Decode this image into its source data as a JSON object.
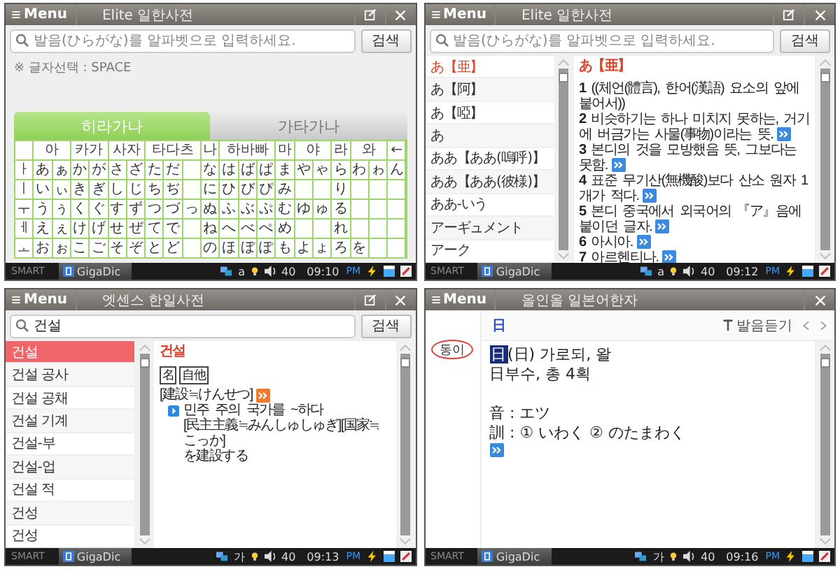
{
  "screens": [
    {
      "kind": "keyboard",
      "title": "Elite 일한사전",
      "menu": "Menu",
      "edit_icon": true,
      "search": {
        "placeholder": "발음(ひらがな)를 알파벳으로 입력하세요.",
        "button": "검색"
      },
      "hint": "※ 글자선택 : SPACE",
      "kana_tabs": [
        {
          "label": "히라가나",
          "selected": true
        },
        {
          "label": "가타가나",
          "selected": false
        }
      ],
      "kana_header": [
        "아",
        "카가",
        "사자",
        "타다츠",
        "나",
        "하바빠",
        "마",
        "야",
        "라",
        "와",
        "←"
      ],
      "kana_rows": [
        {
          "vowel": "ㅏ",
          "groups": [
            [
              {
                "kana": "あ"
              },
              {
                "kana": "ぁ"
              }
            ],
            [
              {
                "kana": "か"
              },
              {
                "kana": "が"
              }
            ],
            [
              {
                "kana": "さ"
              },
              {
                "kana": "ざ"
              }
            ],
            [
              {
                "kana": "た"
              },
              {
                "kana": "だ"
              },
              {
                "blank": true
              }
            ],
            [
              {
                "kana": "な"
              }
            ],
            [
              {
                "kana": "は"
              },
              {
                "kana": "ば"
              },
              {
                "kana": "ぱ"
              }
            ],
            [
              {
                "kana": "ま"
              }
            ],
            [
              {
                "kana": "や"
              },
              {
                "kana": "ゃ"
              }
            ],
            [
              {
                "kana": "ら"
              }
            ],
            [
              {
                "kana": "わ"
              },
              {
                "kana": "ゎ"
              }
            ],
            [
              {
                "kana": "ん"
              }
            ]
          ]
        },
        {
          "vowel": "ㅣ",
          "groups": [
            [
              {
                "kana": "い"
              },
              {
                "kana": "ぃ"
              }
            ],
            [
              {
                "kana": "き"
              },
              {
                "kana": "ぎ"
              }
            ],
            [
              {
                "kana": "し"
              },
              {
                "kana": "じ"
              }
            ],
            [
              {
                "kana": "ち"
              },
              {
                "kana": "ぢ"
              },
              {
                "blank": true
              }
            ],
            [
              {
                "kana": "に"
              }
            ],
            [
              {
                "kana": "ひ"
              },
              {
                "kana": "び"
              },
              {
                "kana": "ぴ"
              }
            ],
            [
              {
                "kana": "み"
              }
            ],
            [
              {
                "blank": true
              },
              {
                "blank": true
              }
            ],
            [
              {
                "kana": "り"
              }
            ],
            [
              {
                "blank": true
              },
              {
                "blank": true
              }
            ],
            [
              {
                "blank": true
              }
            ]
          ]
        },
        {
          "vowel": "ㅜ",
          "groups": [
            [
              {
                "kana": "う"
              },
              {
                "kana": "ぅ"
              }
            ],
            [
              {
                "kana": "く"
              },
              {
                "kana": "ぐ"
              }
            ],
            [
              {
                "kana": "す"
              },
              {
                "kana": "ず"
              }
            ],
            [
              {
                "kana": "つ"
              },
              {
                "kana": "づ"
              },
              {
                "kana": "っ"
              }
            ],
            [
              {
                "kana": "ぬ"
              }
            ],
            [
              {
                "kana": "ふ"
              },
              {
                "kana": "ぶ"
              },
              {
                "kana": "ぷ"
              }
            ],
            [
              {
                "kana": "む"
              }
            ],
            [
              {
                "kana": "ゆ"
              },
              {
                "kana": "ゅ"
              }
            ],
            [
              {
                "kana": "る"
              }
            ],
            [
              {
                "blank": true
              },
              {
                "blank": true
              }
            ],
            [
              {
                "blank": true
              }
            ]
          ]
        },
        {
          "vowel": "ㅔ",
          "groups": [
            [
              {
                "kana": "え"
              },
              {
                "kana": "ぇ"
              }
            ],
            [
              {
                "kana": "け"
              },
              {
                "kana": "げ"
              }
            ],
            [
              {
                "kana": "せ"
              },
              {
                "kana": "ぜ"
              }
            ],
            [
              {
                "kana": "て"
              },
              {
                "kana": "で"
              },
              {
                "blank": true
              }
            ],
            [
              {
                "kana": "ね"
              }
            ],
            [
              {
                "kana": "へ"
              },
              {
                "kana": "べ"
              },
              {
                "kana": "ぺ"
              }
            ],
            [
              {
                "kana": "め"
              }
            ],
            [
              {
                "blank": true
              },
              {
                "blank": true
              }
            ],
            [
              {
                "kana": "れ"
              }
            ],
            [
              {
                "blank": true
              },
              {
                "blank": true
              }
            ],
            [
              {
                "blank": true
              }
            ]
          ]
        },
        {
          "vowel": "ㅗ",
          "groups": [
            [
              {
                "kana": "お"
              },
              {
                "kana": "ぉ"
              }
            ],
            [
              {
                "kana": "こ"
              },
              {
                "kana": "ご"
              }
            ],
            [
              {
                "kana": "そ"
              },
              {
                "kana": "ぞ"
              }
            ],
            [
              {
                "kana": "と"
              },
              {
                "kana": "ど"
              },
              {
                "blank": true
              }
            ],
            [
              {
                "kana": "の"
              }
            ],
            [
              {
                "kana": "ほ"
              },
              {
                "kana": "ぼ"
              },
              {
                "kana": "ぽ"
              }
            ],
            [
              {
                "kana": "も"
              }
            ],
            [
              {
                "kana": "よ"
              },
              {
                "kana": "ょ"
              }
            ],
            [
              {
                "kana": "ろ"
              }
            ],
            [
              {
                "kana": "を"
              },
              {
                "blank": true
              }
            ],
            [
              {
                "blank": true
              }
            ]
          ]
        }
      ],
      "taskbar": {
        "brand": "SMART",
        "app": "GigaDic",
        "ime": "a",
        "volume": "40",
        "time": "09:10",
        "ampm": "PM"
      }
    },
    {
      "kind": "dictionary",
      "title": "Elite 일한사전",
      "menu": "Menu",
      "edit_icon": true,
      "search": {
        "placeholder": "발음(ひらがな)를 알파벳으로 입력하세요.",
        "button": "검색"
      },
      "list_focused": false,
      "list": [
        {
          "label": "あ【亜】",
          "selected": true
        },
        {
          "label": "あ【阿】",
          "selected": false
        },
        {
          "label": "あ【啞】",
          "selected": false
        },
        {
          "label": "あ",
          "selected": false
        },
        {
          "label": "ああ【ああ(嗚呼)】",
          "selected": false
        },
        {
          "label": "ああ【ああ(彼様)】",
          "selected": false
        },
        {
          "label": "ああ-いう",
          "selected": false
        },
        {
          "label": "アーギュメント",
          "selected": false
        },
        {
          "label": "アーク",
          "selected": false
        }
      ],
      "entry": {
        "headword": "あ【亜】",
        "lines": [
          {
            "kind": "sense",
            "text": "**1** ((체언(體言), 한어(漢語) 요소의 앞에 붙어서))",
            "more": false
          },
          {
            "kind": "sense",
            "text": "**2** 비슷하기는 하나 미치지 못하는, 거기에 버금가는 사물(事物)이라는 뜻.",
            "more": true
          },
          {
            "kind": "sense",
            "text": "**3** 본디의 것을 모방했음 뜻, 그보다는 못함.",
            "more": true
          },
          {
            "kind": "sense",
            "text": "**4** 표준 무기산(無機酸)보다 산소 원자 1개가 적다.",
            "more": true
          },
          {
            "kind": "sense",
            "text": "**5** 본디 중국에서 외국어의 『ア』음에 붙이던 글자.",
            "more": true
          },
          {
            "kind": "sense",
            "text": "**6** 아시아.",
            "more": true
          },
          {
            "kind": "sense",
            "text": "**7** 아르헨티나.",
            "more": true
          }
        ]
      },
      "taskbar": {
        "brand": "SMART",
        "app": "GigaDic",
        "ime": "a",
        "volume": "40",
        "time": "09:12",
        "ampm": "PM"
      }
    },
    {
      "kind": "dictionary",
      "title": "엣센스 한일사전",
      "menu": "Menu",
      "edit_icon": true,
      "search": {
        "value": "건설",
        "button": "검색"
      },
      "list_focused": true,
      "list": [
        {
          "label": "건설",
          "selected": true
        },
        {
          "label": "건설 공사",
          "selected": false
        },
        {
          "label": "건설 공채",
          "selected": false
        },
        {
          "label": "건설 기계",
          "selected": false
        },
        {
          "label": "건설-부",
          "selected": false
        },
        {
          "label": "건설-업",
          "selected": false
        },
        {
          "label": "건설 적",
          "selected": false
        },
        {
          "label": "건성",
          "selected": false
        },
        {
          "label": "건성",
          "selected": false
        }
      ],
      "entry": {
        "headword": "건설",
        "tags": [
          "名",
          "自他"
        ],
        "lines": [
          {
            "kind": "reading",
            "text": "[建設≒けんせつ]",
            "more": true
          },
          {
            "kind": "example",
            "text": "민주 주의 국가를 ~하다",
            "more": false
          },
          {
            "kind": "indent",
            "text": "[民主主義≒みんしゅしゅぎ][国家≒こっか]",
            "more": false
          },
          {
            "kind": "indent",
            "text": "を建設する",
            "more": false
          }
        ]
      },
      "taskbar": {
        "brand": "SMART",
        "app": "GigaDic",
        "ime": "가",
        "volume": "40",
        "time": "09:13",
        "ampm": "PM"
      }
    },
    {
      "kind": "kanji",
      "title": "올인올 일본어한자",
      "menu": "Menu",
      "edit_icon": false,
      "header": "日",
      "listen": "발음듣기",
      "side_word": "동이",
      "kanji_lines": [
        {
          "kind": "text",
          "highlight": "日",
          "text": "(日) 가로되, 왈"
        },
        {
          "kind": "text",
          "text": "日부수, 총 4획"
        },
        {
          "kind": "blank"
        },
        {
          "kind": "text",
          "text": "音 : エツ"
        },
        {
          "kind": "text",
          "text": "訓 : ① いわく ② のたまわく"
        }
      ],
      "more": true,
      "taskbar": {
        "brand": "SMART",
        "app": "GigaDic",
        "ime": "가",
        "volume": "40",
        "time": "09:16",
        "ampm": "PM"
      }
    }
  ]
}
